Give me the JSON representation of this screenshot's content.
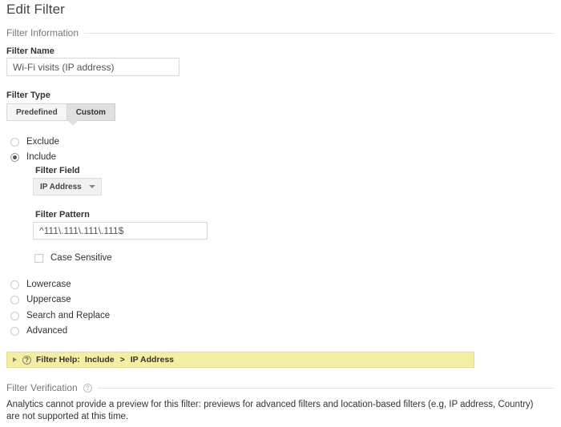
{
  "page": {
    "title": "Edit Filter"
  },
  "filter_information": {
    "section_label": "Filter Information",
    "filter_name": {
      "label": "Filter Name",
      "value": "Wi-Fi visits (IP address)",
      "placeholder": "Filter Name"
    },
    "filter_type": {
      "label": "Filter Type",
      "tabs": [
        {
          "label": "Predefined",
          "selected": false
        },
        {
          "label": "Custom",
          "selected": true
        }
      ],
      "selected_tab": "Custom"
    },
    "custom_options": [
      {
        "label": "Exclude",
        "selected": false
      },
      {
        "label": "Include",
        "selected": true
      },
      {
        "label": "Lowercase",
        "selected": false
      },
      {
        "label": "Uppercase",
        "selected": false
      },
      {
        "label": "Search and Replace",
        "selected": false
      },
      {
        "label": "Advanced",
        "selected": false
      }
    ],
    "filter_field": {
      "label": "Filter Field",
      "value": "IP Address"
    },
    "filter_pattern": {
      "label": "Filter Pattern",
      "value": "^111\\.111\\.111\\.111$",
      "placeholder": "Filter Pattern"
    },
    "case_sensitive": {
      "label": "Case Sensitive",
      "checked": false
    }
  },
  "filter_help": {
    "prefix": "Filter Help:",
    "mode": "Include",
    "separator": ">",
    "field": "IP Address",
    "icon": "question-mark-icon",
    "expanded": false
  },
  "filter_verification": {
    "section_label": "Filter Verification",
    "help_icon": "question-mark-icon",
    "message": "Analytics cannot provide a preview for this filter: previews for advanced filters and location-based filters (e.g, IP address, Country) are not supported at this time."
  },
  "colors": {
    "help_bar_background": "#f4eda4",
    "help_bar_border": "#e4dc94",
    "tab_selected": "#e0e0e0",
    "tab_unselected": "#f6f6f6",
    "rule": "#e4e4e4",
    "text": "#333333",
    "muted_text": "#777777"
  }
}
